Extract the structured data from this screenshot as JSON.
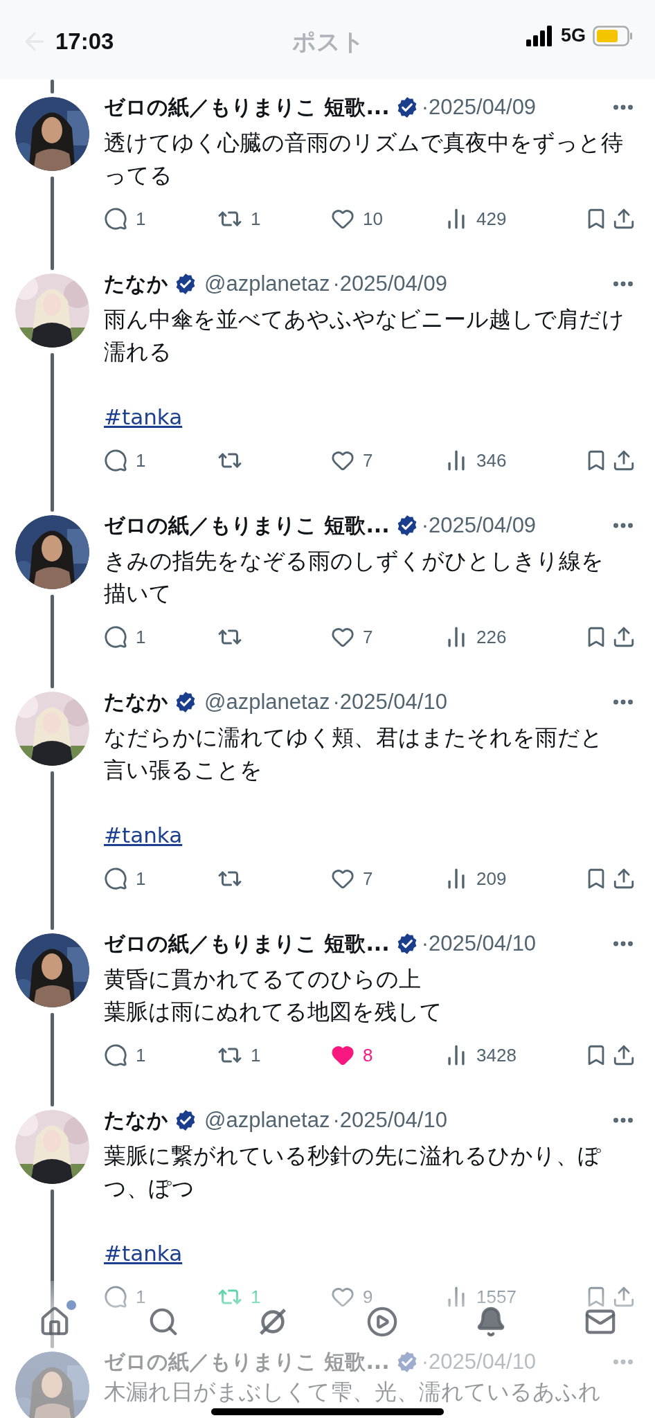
{
  "status_bar": {
    "time": "17:03",
    "network": "5G"
  },
  "header": {
    "title": "ポスト"
  },
  "tweets": [
    {
      "author": "ゼロの紙／もりまりこ 短歌...",
      "verified": true,
      "date": "·2025/04/09",
      "text": "透けてゆく心臓の音雨のリズムで真夜中をずっと待ってる",
      "actions": {
        "replies": "1",
        "reposts": "1",
        "reposted": false,
        "likes": "10",
        "liked": false,
        "views": "429"
      }
    },
    {
      "author": "たなか",
      "verified": true,
      "handle": "@azplanetaz",
      "date": "·2025/04/09",
      "text": "雨ん中傘を並べてあやふやなビニール越しで肩だけ濡れる",
      "hashtag": "#tanka",
      "actions": {
        "replies": "1",
        "reposted": false,
        "likes": "7",
        "liked": false,
        "views": "346"
      }
    },
    {
      "author": "ゼロの紙／もりまりこ 短歌...",
      "verified": true,
      "date": "·2025/04/09",
      "text": "きみの指先をなぞる雨のしずくがひとしきり線を描いて",
      "actions": {
        "replies": "1",
        "reposted": false,
        "likes": "7",
        "liked": false,
        "views": "226"
      }
    },
    {
      "author": "たなか",
      "verified": true,
      "handle": "@azplanetaz",
      "date": "·2025/04/10",
      "text": "なだらかに濡れてゆく頬、君はまたそれを雨だと言い張ることを",
      "hashtag": "#tanka",
      "actions": {
        "replies": "1",
        "reposted": false,
        "likes": "7",
        "liked": false,
        "views": "209"
      }
    },
    {
      "author": "ゼロの紙／もりまりこ 短歌...",
      "verified": true,
      "date": "·2025/04/10",
      "text": "黄昏に貫かれてるてのひらの上",
      "text_2": "葉脈は雨にぬれてる地図を残して",
      "actions": {
        "replies": "1",
        "reposts": "1",
        "reposted": false,
        "likes": "8",
        "liked": true,
        "views": "3428"
      }
    },
    {
      "author": "たなか",
      "verified": true,
      "handle": "@azplanetaz",
      "date": "·2025/04/10",
      "text": "葉脈に繋がれている秒針の先に溢れるひかり、ぽつ、ぽつ",
      "hashtag": "#tanka",
      "actions": {
        "replies": "1",
        "reposts": "1",
        "reposted": true,
        "likes": "9",
        "liked": false,
        "views": "1557"
      }
    },
    {
      "author": "ゼロの紙／もりまりこ 短歌...",
      "verified": true,
      "date": "·2025/04/10",
      "text": "木漏れ日がまぶしくて雫、光、濡れているあふれ"
    }
  ],
  "nav": [
    {
      "kind": "home",
      "has_badge": true
    },
    {
      "kind": "search",
      "has_badge": false
    },
    {
      "kind": "grok",
      "has_badge": false
    },
    {
      "kind": "video",
      "has_badge": false
    },
    {
      "kind": "notifications",
      "has_badge": false
    },
    {
      "kind": "messages",
      "has_badge": false
    }
  ]
}
